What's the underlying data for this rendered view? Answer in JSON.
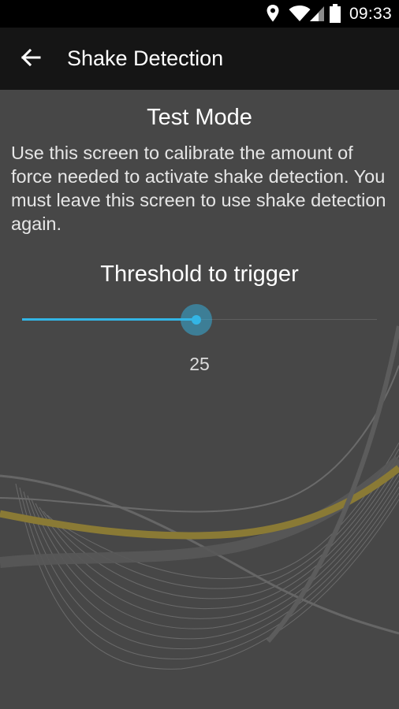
{
  "status_bar": {
    "time": "09:33",
    "icons": [
      "location-icon",
      "wifi-icon",
      "cell-signal-icon",
      "battery-icon"
    ]
  },
  "toolbar": {
    "back_icon": "arrow-back-icon",
    "title": "Shake Detection"
  },
  "main": {
    "heading": "Test Mode",
    "description": "Use this screen to calibrate the amount of force needed to activate shake detection. You must leave this screen to use shake detection again.",
    "slider": {
      "label": "Threshold to trigger",
      "value": "25",
      "fraction": 0.49
    }
  },
  "colors": {
    "accent": "#33b5e5",
    "background": "#474747",
    "toolbar": "#151515",
    "status_bar": "#000000",
    "wave_gold": "#8a7a35"
  }
}
